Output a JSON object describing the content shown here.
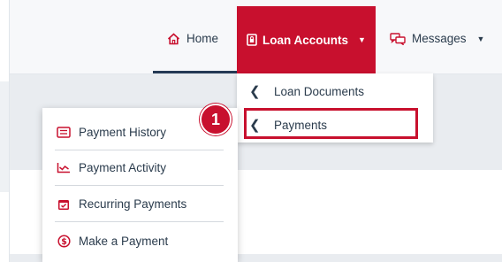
{
  "nav": {
    "home_label": "Home",
    "loan_accounts_label": "Loan Accounts",
    "messages_label": "Messages",
    "home_icon": "home-icon",
    "loan_icon": "document-lock-icon",
    "messages_icon": "chat-bubbles-icon",
    "active_color": "#c8102e"
  },
  "loan_submenu": {
    "items": [
      {
        "label": "Loan Documents",
        "icon": "chevron-left-icon"
      },
      {
        "label": "Payments",
        "icon": "chevron-left-icon",
        "highlighted": true
      }
    ]
  },
  "step_badge": "1",
  "payments_menu": {
    "items": [
      {
        "label": "Payment History",
        "icon": "receipt-icon"
      },
      {
        "label": "Payment Activity",
        "icon": "activity-chart-icon"
      },
      {
        "label": "Recurring Payments",
        "icon": "calendar-check-icon"
      },
      {
        "label": "Make a Payment",
        "icon": "dollar-circle-icon"
      }
    ]
  }
}
